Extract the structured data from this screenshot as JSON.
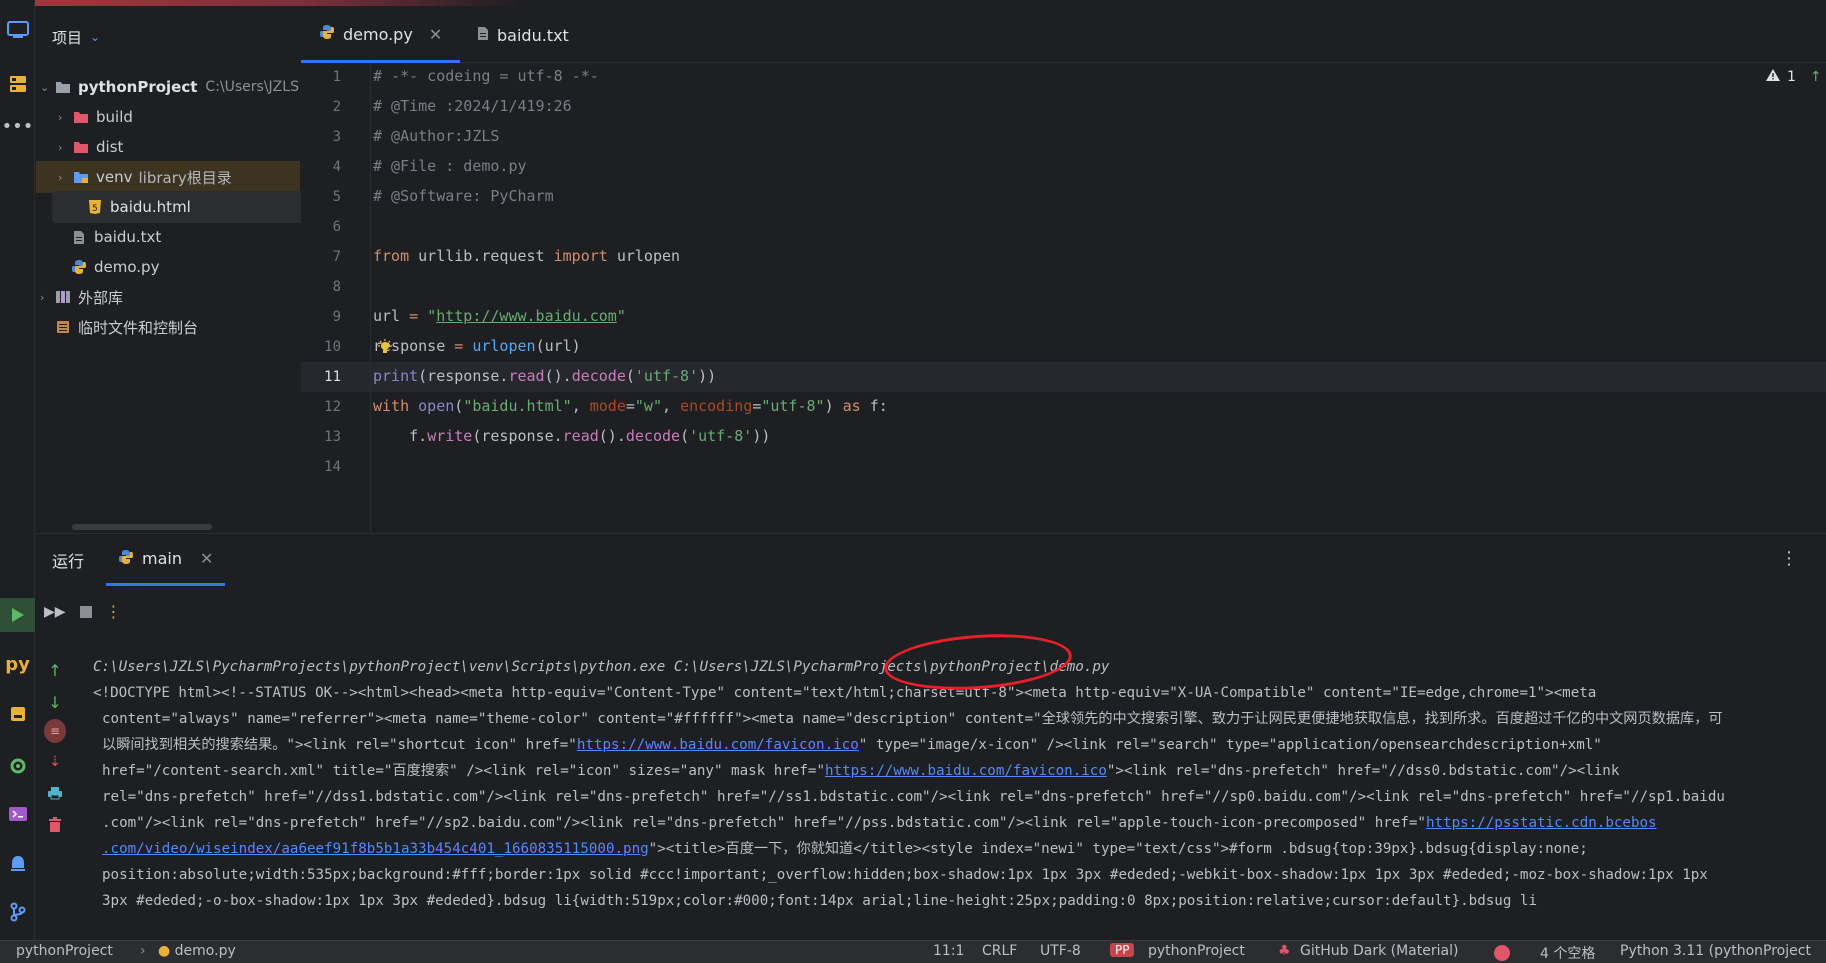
{
  "project_panel": {
    "title": "项目",
    "root": {
      "name": "pythonProject",
      "path": "C:\\Users\\JZLS"
    },
    "items": [
      {
        "label": "build"
      },
      {
        "label": "dist"
      },
      {
        "label": "venv",
        "note": "library根目录"
      },
      {
        "label": "baidu.html"
      },
      {
        "label": "baidu.txt"
      },
      {
        "label": "demo.py"
      }
    ],
    "external": "外部库",
    "scratches": "临时文件和控制台"
  },
  "editor_tabs": [
    {
      "label": "demo.py"
    },
    {
      "label": "baidu.txt"
    }
  ],
  "editor": {
    "line_numbers": [
      "1",
      "2",
      "3",
      "4",
      "5",
      "6",
      "7",
      "8",
      "9",
      "10",
      "11",
      "12",
      "13",
      "14"
    ],
    "current_line": "11",
    "warnings_count": "1",
    "lines": {
      "l1": "# -*- codeing = utf-8 -*-",
      "l2": "# @Time :2024/1/419:26",
      "l3": "# @Author:JZLS",
      "l4": "# @File : demo.py",
      "l5": "# @Software: PyCharm",
      "l7_kw1": "from",
      "l7_mod": " urllib.request ",
      "l7_kw2": "import",
      "l7_name": " urlopen",
      "l9_var": "url",
      "l9_eq": " = ",
      "l9_q1": "\"",
      "l9_url": "http://www.baidu.com",
      "l9_q2": "\"",
      "l10_var": "response",
      "l10_eq": " = ",
      "l10_fn": "urlopen",
      "l10_rest": "(url)",
      "l11_fn": "print",
      "l11_a": "(response.",
      "l11_read": "read",
      "l11_b": "().",
      "l11_decode": "decode",
      "l11_c": "(",
      "l11_str": "'utf-8'",
      "l11_d": "))",
      "l12_kw": "with",
      "l12_open": " open",
      "l12_a": "(",
      "l12_s1": "\"baidu.html\"",
      "l12_b": ", ",
      "l12_p1": "mode",
      "l12_c": "=",
      "l12_s2": "\"w\"",
      "l12_d": ", ",
      "l12_p2": "encoding",
      "l12_e": "=",
      "l12_s3": "\"utf-8\"",
      "l12_f": ") ",
      "l12_as": "as",
      "l12_g": " f:",
      "l13_a": "    f.",
      "l13_write": "write",
      "l13_b": "(response.",
      "l13_read": "read",
      "l13_c": "().",
      "l13_decode": "decode",
      "l13_d": "(",
      "l13_str": "'utf-8'",
      "l13_e": "))"
    }
  },
  "run_panel": {
    "title": "运行",
    "tab_label": "main",
    "console": {
      "cmd": "C:\\Users\\JZLS\\PycharmProjects\\pythonProject\\venv\\Scripts\\python.exe C:\\Users\\JZLS\\PycharmProjects\\pythonProject\\demo.py",
      "l1": "<!DOCTYPE html><!--STATUS OK--><html><head><meta http-equiv=\"Content-Type\" content=\"text/html;charset=utf-8\"><meta http-equiv=\"X-UA-Compatible\" content=\"IE=edge,chrome=1\"><meta",
      "l2": "content=\"always\" name=\"referrer\"><meta name=\"theme-color\" content=\"#ffffff\"><meta name=\"description\" content=\"全球领先的中文搜索引擎、致力于让网民更便捷地获取信息，找到所求。百度超过千亿的中文网页数据库，可",
      "l3_a": "以瞬间找到相关的搜索结果。\"><link rel=\"shortcut icon\" href=\"",
      "l3_link": "https://www.baidu.com/favicon.ico",
      "l3_b": "\" type=\"image/x-icon\" /><link rel=\"search\" type=\"application/opensearchdescription+xml\"",
      "l4_a": "href=\"/content-search.xml\" title=\"百度搜索\" /><link rel=\"icon\" sizes=\"any\" mask href=\"",
      "l4_link": "https://www.baidu.com/favicon.ico",
      "l4_b": "\"><link rel=\"dns-prefetch\" href=\"//dss0.bdstatic.com\"/><link",
      "l5": "rel=\"dns-prefetch\" href=\"//dss1.bdstatic.com\"/><link rel=\"dns-prefetch\" href=\"//ss1.bdstatic.com\"/><link rel=\"dns-prefetch\" href=\"//sp0.baidu.com\"/><link rel=\"dns-prefetch\" href=\"//sp1.baidu",
      "l6_a": ".com\"/><link rel=\"dns-prefetch\" href=\"//sp2.baidu.com\"/><link rel=\"dns-prefetch\" href=\"//pss.bdstatic.com\"/><link rel=\"apple-touch-icon-precomposed\" href=\"",
      "l6_link": "https://psstatic.cdn.bcebos",
      "l7_link": ".com/video/wiseindex/aa6eef91f8b5b1a33b454c401_1660835115000.png",
      "l7_b": "\"><title>百度一下，你就知道</title><style index=\"newi\" type=\"text/css\">#form .bdsug{top:39px}.bdsug{display:none;",
      "l8": "position:absolute;width:535px;background:#fff;border:1px solid #ccc!important;_overflow:hidden;box-shadow:1px 1px 3px #ededed;-webkit-box-shadow:1px 1px 3px #ededed;-moz-box-shadow:1px 1px",
      "l9": "3px #ededed;-o-box-shadow:1px 1px 3px #ededed}.bdsug li{width:519px;color:#000;font:14px arial;line-height:25px;padding:0 8px;position:relative;cursor:default}.bdsug li"
    }
  },
  "status_bar": {
    "project": "pythonProject",
    "file": "demo.py",
    "position": "11:1",
    "line_sep": "CRLF",
    "encoding": "UTF-8",
    "project_badge": "PP",
    "project2": "pythonProject",
    "theme": "GitHub Dark (Material)",
    "indent": "4 个空格",
    "interpreter": "Python 3.11 (pythonProject"
  },
  "colors": {
    "accent": "#3574f0",
    "annotation_red": "#e8202a"
  }
}
